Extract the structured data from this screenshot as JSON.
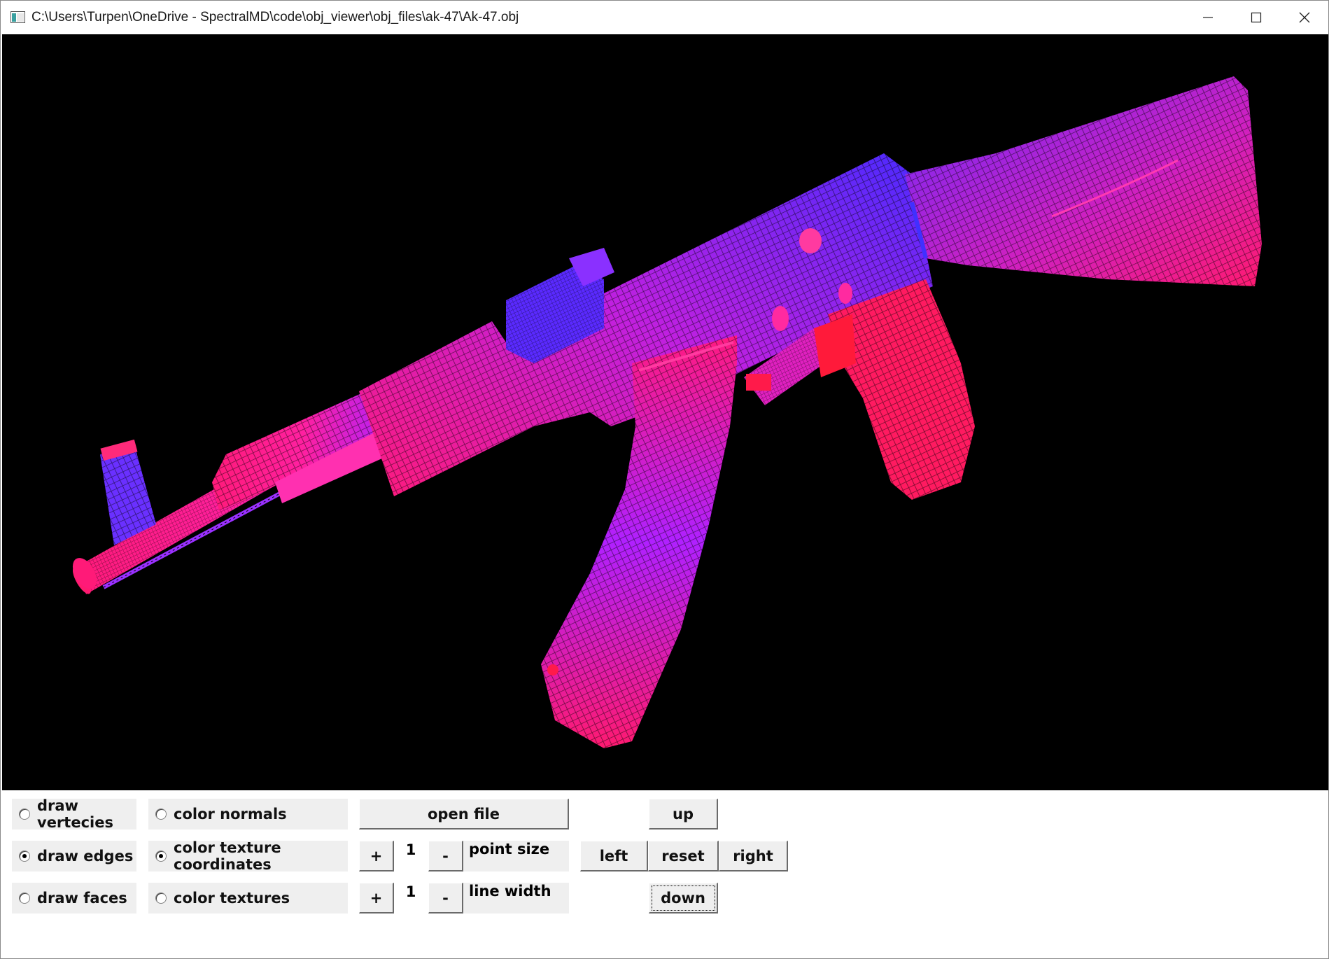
{
  "window": {
    "title": "C:\\Users\\Turpen\\OneDrive - SpectralMD\\code\\obj_viewer\\obj_files\\ak-47\\Ak-47.obj",
    "controls": [
      "minimize-icon",
      "maximize-icon",
      "close-icon"
    ]
  },
  "viewport": {
    "background": "#000000",
    "render_mode": "wireframe",
    "model": "Ak-47.obj",
    "colors": [
      "#ff1a8c",
      "#3a2aff",
      "#ff1a3a",
      "#c020ff"
    ]
  },
  "options": {
    "draw_vertices": {
      "label": "draw vertecies",
      "selected": false
    },
    "draw_edges": {
      "label": "draw edges",
      "selected": true
    },
    "draw_faces": {
      "label": "draw faces",
      "selected": false
    },
    "color_normals": {
      "label": "color normals",
      "selected": false
    },
    "color_texcoords": {
      "label": "color texture coordinates",
      "selected": true
    },
    "color_textures": {
      "label": "color textures",
      "selected": false
    }
  },
  "controls": {
    "open_file": "open file",
    "plus": "+",
    "minus": "-",
    "point_size": {
      "value": "1",
      "label": "point size"
    },
    "line_width": {
      "value": "1",
      "label": "line width"
    }
  },
  "nav": {
    "up": "up",
    "left": "left",
    "reset": "reset",
    "right": "right",
    "down": "down"
  }
}
